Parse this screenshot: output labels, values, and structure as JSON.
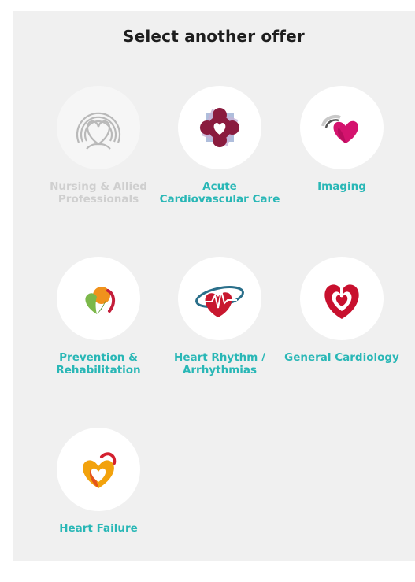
{
  "header": {
    "title": "Select another offer"
  },
  "offers": [
    {
      "label": "Nursing & Allied\nProfessionals",
      "icon": "nursing-rings-heart-icon",
      "state": "disabled"
    },
    {
      "label": "Acute\nCardiovascular Care",
      "icon": "acute-care-flower-heart-icon",
      "state": "enabled"
    },
    {
      "label": "Imaging",
      "icon": "imaging-heart-icon",
      "state": "enabled"
    },
    {
      "label": "Prevention &\nRehabilitation",
      "icon": "prevention-heart-icon",
      "state": "enabled"
    },
    {
      "label": "Heart Rhythm /\nArrhythmias",
      "icon": "heart-rhythm-ecg-icon",
      "state": "enabled"
    },
    {
      "label": "General Cardiology",
      "icon": "general-cardiology-heart-icon",
      "state": "enabled"
    },
    {
      "label": "Heart Failure",
      "icon": "heart-failure-icon",
      "state": "enabled"
    }
  ],
  "colors": {
    "label_teal": "#29b7b6",
    "label_disabled": "#cfcfcf",
    "panel_background": "#f0f0f0",
    "title_text": "#1e1e1e"
  }
}
